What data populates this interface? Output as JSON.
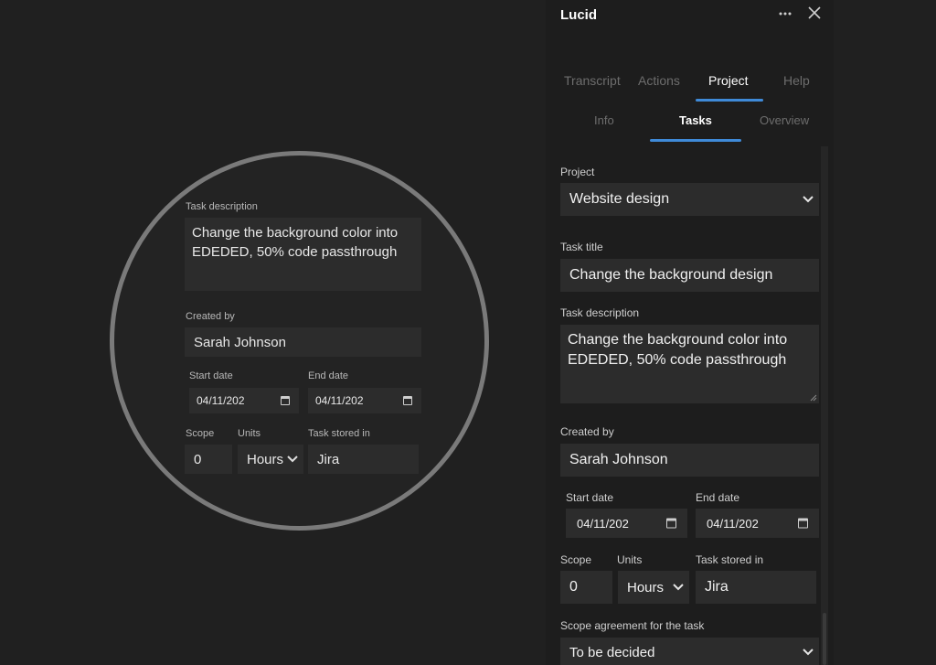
{
  "app": {
    "title": "Lucid",
    "more_icon": "more-horizontal-icon",
    "close_icon": "close-icon"
  },
  "tabs": [
    "Transcript",
    "Actions",
    "Project",
    "Help"
  ],
  "active_tab": "Project",
  "subtabs": [
    "Info",
    "Tasks",
    "Overview"
  ],
  "active_subtab": "Tasks",
  "accent_color": "#3f8ad8",
  "form": {
    "project_label": "Project",
    "project_value": "Website design",
    "task_title_label": "Task title",
    "task_title_value": "Change the background design",
    "task_description_label": "Task description",
    "task_description_value": "Change the background color into EDEDED, 50% code passthrough",
    "created_by_label": "Created by",
    "created_by_value": "Sarah Johnson",
    "start_date_label": "Start date",
    "start_date_value": "04/11/202",
    "end_date_label": "End date",
    "end_date_value": "04/11/202",
    "scope_label": "Scope",
    "scope_value": "0",
    "units_label": "Units",
    "units_value": "Hours",
    "task_stored_label": "Task stored in",
    "task_stored_value": "Jira",
    "scope_agreement_label": "Scope agreement for the task",
    "scope_agreement_value": "To be decided"
  }
}
